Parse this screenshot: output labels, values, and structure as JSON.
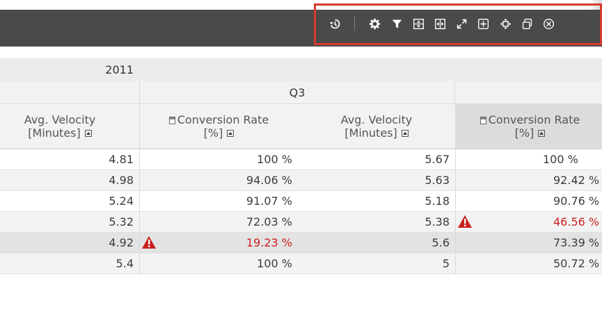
{
  "colors": {
    "toolbar_bg": "#4a4a4a",
    "highlight_border": "#d83a2c",
    "alert_red": "#cc1f1f"
  },
  "toolbar": {
    "icons": [
      "history-icon",
      "settings-gear-icon",
      "filter-icon",
      "swap-vertical-icon",
      "swap-horizontal-icon",
      "expand-icon",
      "add-icon",
      "move-icon",
      "copy-icon",
      "close-icon"
    ]
  },
  "table": {
    "year_label": "2011",
    "quarter_label": "Q3",
    "columns": [
      {
        "line1": "Avg. Velocity",
        "line2": "[Minutes]",
        "calc": false
      },
      {
        "line1": "Conversion Rate",
        "line2": "[%]",
        "calc": true
      },
      {
        "line1": "Avg. Velocity",
        "line2": "[Minutes]",
        "calc": false
      },
      {
        "line1": "Conversion Rate",
        "line2": "[%]",
        "calc": true
      }
    ],
    "rows": [
      {
        "c1": "4.81",
        "c2": "100 %",
        "c3": "5.67",
        "c4": "100 %",
        "alert2": false,
        "alert4": false
      },
      {
        "c1": "4.98",
        "c2": "94.06 %",
        "c3": "5.63",
        "c4": "92.42 %",
        "alert2": false,
        "alert4": false
      },
      {
        "c1": "5.24",
        "c2": "91.07 %",
        "c3": "5.18",
        "c4": "90.76 %",
        "alert2": false,
        "alert4": false
      },
      {
        "c1": "5.32",
        "c2": "72.03 %",
        "c3": "5.38",
        "c4": "46.56 %",
        "alert2": false,
        "alert4": true
      },
      {
        "c1": "4.92",
        "c2": "19.23 %",
        "c3": "5.6",
        "c4": "73.39 %",
        "alert2": true,
        "alert4": false
      },
      {
        "c1": "5.4",
        "c2": "100 %",
        "c3": "5",
        "c4": "50.72 %",
        "alert2": false,
        "alert4": false
      }
    ]
  }
}
